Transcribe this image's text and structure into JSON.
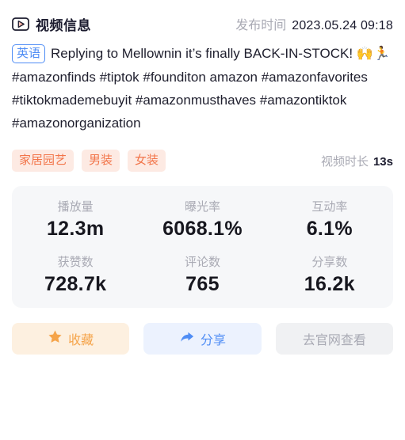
{
  "header": {
    "icon": "video-play-icon",
    "title": "视频信息",
    "publish_label": "发布时间",
    "publish_value": "2023.05.24 09:18"
  },
  "description": {
    "language_badge": "英语",
    "text_part_1": "Replying to Mellownin it’s finally BACK-IN-STOCK! ",
    "emoji_1": "🙌",
    "emoji_2": "🏃",
    "text_part_2": " #amazonfinds #tiptok #founditon amazon #amazonfavorites #tiktokmademebuyit #amazonmusthaves #amazontiktok #amazonorganization"
  },
  "tags": [
    {
      "label": "家居园艺"
    },
    {
      "label": "男装"
    },
    {
      "label": "女装"
    }
  ],
  "duration": {
    "label": "视频时长",
    "value": "13s"
  },
  "stats": {
    "row1": [
      {
        "label": "播放量",
        "value": "12.3m"
      },
      {
        "label": "曝光率",
        "value": "6068.1%"
      },
      {
        "label": "互动率",
        "value": "6.1%"
      }
    ],
    "row2": [
      {
        "label": "获赞数",
        "value": "728.7k"
      },
      {
        "label": "评论数",
        "value": "765"
      },
      {
        "label": "分享数",
        "value": "16.2k"
      }
    ]
  },
  "actions": [
    {
      "label": "收藏",
      "icon": "star-icon"
    },
    {
      "label": "分享",
      "icon": "share-arrow-icon"
    },
    {
      "label": "去官网查看",
      "icon": "none"
    }
  ],
  "colors": {
    "accent_orange": "#f2754a",
    "accent_blue": "#4f8df5",
    "star_orange": "#f5a44a",
    "muted_gray": "#a9aab4",
    "text_dark": "#17171f",
    "card_bg": "#f6f7f9",
    "tag_bg": "#fdeae3"
  }
}
